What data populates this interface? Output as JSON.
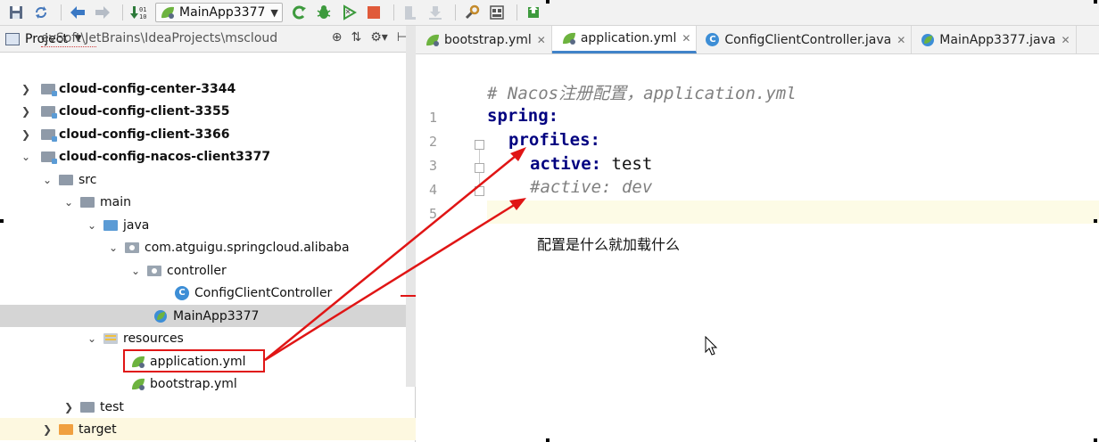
{
  "toolbar": {
    "run_config": "MainApp3377"
  },
  "project_panel": {
    "title": "Project",
    "path_hint": "evSoft\\JetBrains\\IdeaProjects\\mscloud",
    "tree": [
      {
        "label": "cloud-config-center-3344",
        "expanded": false
      },
      {
        "label": "cloud-config-client-3355",
        "expanded": false
      },
      {
        "label": "cloud-config-client-3366",
        "expanded": false
      },
      {
        "label": "cloud-config-nacos-client3377",
        "expanded": true
      },
      {
        "label": "src"
      },
      {
        "label": "main"
      },
      {
        "label": "java"
      },
      {
        "label": "com.atguigu.springcloud.alibaba"
      },
      {
        "label": "controller"
      },
      {
        "label": "ConfigClientController"
      },
      {
        "label": "MainApp3377",
        "selected": true
      },
      {
        "label": "resources"
      },
      {
        "label": "application.yml",
        "boxed": true
      },
      {
        "label": "bootstrap.yml"
      },
      {
        "label": "test"
      },
      {
        "label": "target"
      }
    ]
  },
  "editor": {
    "tabs": [
      {
        "label": "bootstrap.yml",
        "active": false
      },
      {
        "label": "application.yml",
        "active": true
      },
      {
        "label": "ConfigClientController.java",
        "active": false
      },
      {
        "label": "MainApp3377.java",
        "active": false
      }
    ],
    "line_numbers": [
      "1",
      "2",
      "3",
      "4",
      "5"
    ],
    "code": {
      "line1": "# Nacos注册配置，application.yml",
      "line2_key": "spring:",
      "line3_key": "profiles:",
      "line4_key": "active:",
      "line4_val": " test",
      "line5": "#active: dev"
    }
  },
  "annotation": "配置是什么就加载什么",
  "colors": {
    "annotation_arrow": "#e01515",
    "yaml_key": "#000080",
    "active_tab_underline": "#4083c9"
  }
}
